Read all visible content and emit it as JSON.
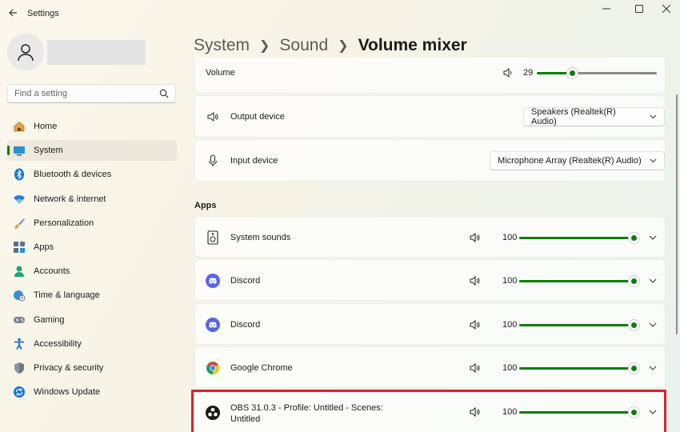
{
  "window": {
    "title": "Settings"
  },
  "search": {
    "placeholder": "Find a setting"
  },
  "sidebar": {
    "items": [
      {
        "label": "Home",
        "icon": "home-icon"
      },
      {
        "label": "System",
        "icon": "system-icon",
        "active": true
      },
      {
        "label": "Bluetooth & devices",
        "icon": "bluetooth-icon"
      },
      {
        "label": "Network & internet",
        "icon": "wifi-icon"
      },
      {
        "label": "Personalization",
        "icon": "brush-icon"
      },
      {
        "label": "Apps",
        "icon": "apps-icon"
      },
      {
        "label": "Accounts",
        "icon": "person-icon"
      },
      {
        "label": "Time & language",
        "icon": "globe-clock-icon"
      },
      {
        "label": "Gaming",
        "icon": "gamepad-icon"
      },
      {
        "label": "Accessibility",
        "icon": "accessibility-icon"
      },
      {
        "label": "Privacy & security",
        "icon": "shield-icon"
      },
      {
        "label": "Windows Update",
        "icon": "update-icon"
      }
    ]
  },
  "breadcrumb": {
    "parts": [
      "System",
      "Sound"
    ],
    "current": "Volume mixer"
  },
  "volume": {
    "label": "Volume",
    "value": "29",
    "level": 29
  },
  "output_device": {
    "label": "Output device",
    "selected": "Speakers (Realtek(R) Audio)"
  },
  "input_device": {
    "label": "Input device",
    "selected": "Microphone Array (Realtek(R) Audio)"
  },
  "apps_section": {
    "title": "Apps",
    "apps": [
      {
        "name": "System sounds",
        "value": "100",
        "level": 100,
        "icon": "speaker-box-icon"
      },
      {
        "name": "Discord",
        "value": "100",
        "level": 100,
        "icon": "discord-icon"
      },
      {
        "name": "Discord",
        "value": "100",
        "level": 100,
        "icon": "discord-icon"
      },
      {
        "name": "Google Chrome",
        "value": "100",
        "level": 100,
        "icon": "chrome-icon"
      },
      {
        "name_line1": "OBS 31.0.3 - Profile: Untitled - Scenes:",
        "name_line2": "Untitled",
        "value": "100",
        "level": 100,
        "icon": "obs-icon",
        "highlighted": true
      }
    ]
  },
  "colors": {
    "accent": "#0f7b0f",
    "highlight": "#d6232d"
  }
}
